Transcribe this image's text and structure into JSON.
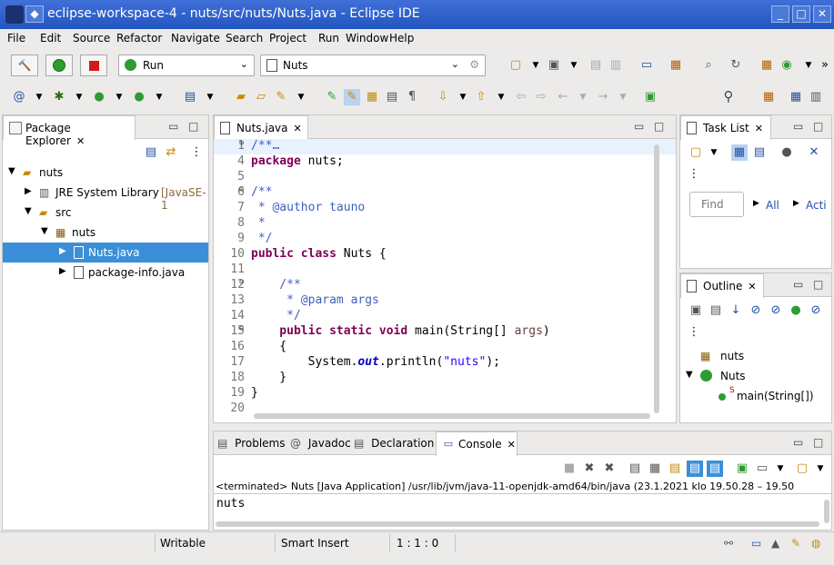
{
  "window": {
    "title": "eclipse-workspace-4 - nuts/src/nuts/Nuts.java - Eclipse IDE"
  },
  "menu": [
    "File",
    "Edit",
    "Source",
    "Refactor",
    "Navigate",
    "Search",
    "Project",
    "Run",
    "Window",
    "Help"
  ],
  "toolbar": {
    "run_config": "Run",
    "project_config": "Nuts"
  },
  "package_explorer": {
    "tab": "Package Explorer",
    "tree": [
      "nuts",
      "JRE System Library",
      "[JavaSE-1",
      "src",
      "nuts",
      "Nuts.java",
      "package-info.java"
    ]
  },
  "editor": {
    "tab": "Nuts.java",
    "lines": [
      {
        "n": "1",
        "segs": [
          [
            "cm",
            "/**"
          ],
          [
            "cm",
            "…"
          ]
        ]
      },
      {
        "n": "4",
        "segs": [
          [
            "kw",
            "package"
          ],
          [
            "",
            "nuts;"
          ]
        ]
      },
      {
        "n": "5",
        "segs": []
      },
      {
        "n": "6",
        "segs": [
          [
            "cm",
            "/**"
          ]
        ]
      },
      {
        "n": "7",
        "segs": [
          [
            "cm",
            " * @author "
          ],
          [
            "cm",
            "tauno"
          ]
        ]
      },
      {
        "n": "8",
        "segs": [
          [
            "cm",
            " *"
          ]
        ]
      },
      {
        "n": "9",
        "segs": [
          [
            "cm",
            " */"
          ]
        ]
      },
      {
        "n": "10",
        "segs": [
          [
            "kw",
            "public class"
          ],
          [
            "",
            " Nuts {"
          ]
        ]
      },
      {
        "n": "11",
        "segs": []
      },
      {
        "n": "12",
        "segs": [
          [
            "cm",
            "    /**"
          ]
        ]
      },
      {
        "n": "13",
        "segs": [
          [
            "cm",
            "     * @param "
          ],
          [
            "cm",
            "args"
          ]
        ]
      },
      {
        "n": "14",
        "segs": [
          [
            "cm",
            "     */"
          ]
        ]
      },
      {
        "n": "15",
        "segs": [
          [
            "kw",
            "    public static void"
          ],
          [
            "",
            " main(String[] "
          ],
          [
            "param",
            "args"
          ],
          [
            "",
            ")"
          ]
        ]
      },
      {
        "n": "16",
        "segs": [
          [
            "",
            "    {"
          ]
        ]
      },
      {
        "n": "17",
        "segs": [
          [
            "",
            "        System."
          ],
          [
            "fld",
            "out"
          ],
          [
            "",
            ".println("
          ],
          [
            "str",
            "\"nuts\""
          ],
          [
            "",
            ");"
          ]
        ]
      },
      {
        "n": "18",
        "segs": [
          [
            "",
            "    }"
          ]
        ]
      },
      {
        "n": "19",
        "segs": [
          [
            "",
            "}"
          ]
        ]
      },
      {
        "n": "20",
        "segs": []
      }
    ]
  },
  "tasklist": {
    "tab": "Task List",
    "find_placeholder": "Find",
    "all": "All",
    "acti": "Acti"
  },
  "outline": {
    "tab": "Outline",
    "items": [
      "nuts",
      "Nuts",
      "main(String[])"
    ],
    "main_mod": "S"
  },
  "bottom": {
    "tabs": [
      "Problems",
      "Javadoc",
      "Declaration",
      "Console"
    ],
    "terminated": "<terminated> Nuts [Java Application] /usr/lib/jvm/java-11-openjdk-amd64/bin/java  (23.1.2021 klo 19.50.28 – 19.50",
    "output": "nuts"
  },
  "status": {
    "writable": "Writable",
    "insert": "Smart Insert",
    "pos": "1 : 1 : 0"
  }
}
